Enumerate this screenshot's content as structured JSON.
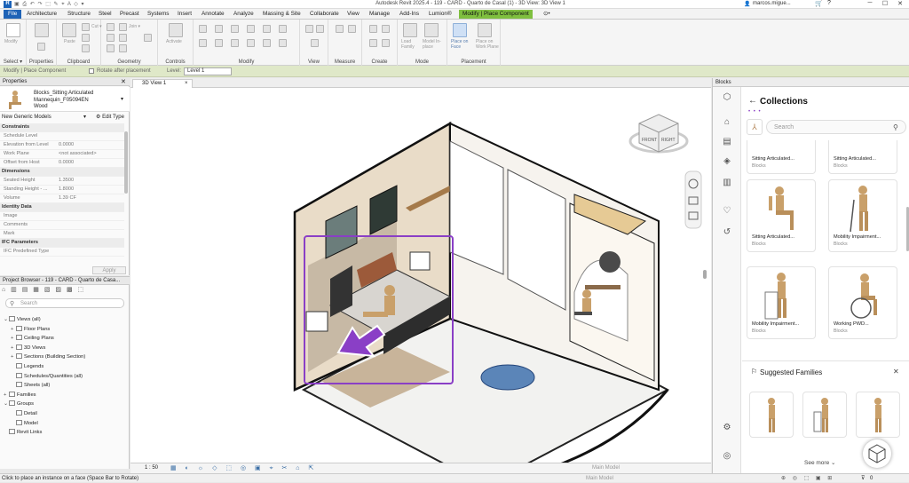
{
  "titlebar": {
    "app_letter": "R",
    "title": "Autodesk Revit 2025.4 - 119 - CARD - Quarto de Casal (1) - 3D View: 3D View 1",
    "user": "marcos.migue...",
    "minimize": "─",
    "maximize": "☐",
    "close": "✕"
  },
  "tabs": [
    "File",
    "Architecture",
    "Structure",
    "Steel",
    "Precast",
    "Systems",
    "Insert",
    "Annotate",
    "Analyze",
    "Massing & Site",
    "Collaborate",
    "View",
    "Manage",
    "Add-Ins",
    "Lumion®",
    "Modify | Place Component",
    "⊙•"
  ],
  "ribbon": {
    "panels": [
      "Select ▾",
      "Properties",
      "Clipboard",
      "Geometry",
      "Controls",
      "Modify",
      "View",
      "Measure",
      "Create",
      "Mode",
      "Placement"
    ],
    "buttons": {
      "modify": "Modify",
      "paste": "Paste",
      "cut": "Cut ▾",
      "join": "Join ▾",
      "activate": "Activate",
      "load_family": "Load Family",
      "model_in_place": "Model In-place",
      "place_on_face": "Place on Face",
      "place_on_work_plane": "Place on Work Plane"
    }
  },
  "optionsbar": {
    "context": "Modify | Place Component",
    "rotate_after": "Rotate after placement",
    "level_label": "Level:",
    "level_value": "Level 1"
  },
  "properties": {
    "header": "Properties",
    "type_name": "Blocks_Sitting Articulated Mannequin_F05094EN",
    "type_sub": "Wood",
    "selector": "New Generic Models",
    "edit_type": "Edit Type",
    "apply": "Apply",
    "rows": [
      {
        "section": true,
        "k": "Constraints",
        "v": ""
      },
      {
        "k": "Schedule Level",
        "v": ""
      },
      {
        "k": "Elevation from Level",
        "v": "0.0000"
      },
      {
        "k": "Work Plane",
        "v": "<not associated>"
      },
      {
        "k": "Offset from Host",
        "v": "0.0000"
      },
      {
        "section": true,
        "k": "Dimensions",
        "v": ""
      },
      {
        "k": "Seated Height",
        "v": "1.3500"
      },
      {
        "k": "Standing Height - ...",
        "v": "1.8000"
      },
      {
        "k": "Volume",
        "v": "1.39 CF"
      },
      {
        "section": true,
        "k": "Identity Data",
        "v": ""
      },
      {
        "k": "Image",
        "v": ""
      },
      {
        "k": "Comments",
        "v": ""
      },
      {
        "k": "Mark",
        "v": ""
      },
      {
        "section": true,
        "k": "IFC Parameters",
        "v": ""
      },
      {
        "k": "IFC Predefined Type",
        "v": ""
      }
    ]
  },
  "project_browser": {
    "header": "Project Browser - 119 - CARD - Quarto de Casa...",
    "search_placeholder": "Search",
    "items": [
      {
        "label": "Views (all)",
        "twisty": "⌄",
        "level": 0
      },
      {
        "label": "Floor Plans",
        "twisty": "+",
        "level": 1
      },
      {
        "label": "Ceiling Plans",
        "twisty": "+",
        "level": 1
      },
      {
        "label": "3D Views",
        "twisty": "+",
        "level": 1
      },
      {
        "label": "Sections (Building Section)",
        "twisty": "+",
        "level": 1
      },
      {
        "label": "Legends",
        "twisty": "",
        "level": 1
      },
      {
        "label": "Schedules/Quantities (all)",
        "twisty": "",
        "level": 1
      },
      {
        "label": "Sheets (all)",
        "twisty": "",
        "level": 1
      },
      {
        "label": "Families",
        "twisty": "+",
        "level": 0
      },
      {
        "label": "Groups",
        "twisty": "⌄",
        "level": 0
      },
      {
        "label": "Detail",
        "twisty": "",
        "level": 1
      },
      {
        "label": "Model",
        "twisty": "",
        "level": 1
      },
      {
        "label": "Revit Links",
        "twisty": "",
        "level": 0
      }
    ]
  },
  "view": {
    "tab_label": "3D View 1",
    "tab_close": "×",
    "viewcube_front": "FRONT",
    "viewcube_right": "RIGHT",
    "scale": "1 : 50",
    "main_model": "Main Model"
  },
  "blocks": {
    "panel_title": "Blocks",
    "heading": "Collections",
    "back": "←",
    "search_placeholder": "Search",
    "cards": [
      {
        "name": "Sitting Articulated...",
        "category": "Blocks"
      },
      {
        "name": "Sitting Articulated...",
        "category": "Blocks"
      },
      {
        "name": "Sitting Articulated...",
        "category": "Blocks"
      },
      {
        "name": "Mobility Impairment...",
        "category": "Blocks"
      },
      {
        "name": "Mobility Impairment...",
        "category": "Blocks"
      },
      {
        "name": "Working PWD...",
        "category": "Blocks"
      }
    ],
    "suggested_title": "Suggested Families",
    "see_more": "See more ⌄",
    "close": "✕"
  },
  "statusbar": {
    "text": "Click to place an instance on a face (Space Bar to Rotate)",
    "filter_count": "0",
    "main_model": "Main Model"
  },
  "colors": {
    "accent_purple": "#8a3fc6",
    "ribbon_context": "#7fbf3f",
    "file_blue": "#1f63b6",
    "wood": "#c9a06a"
  }
}
